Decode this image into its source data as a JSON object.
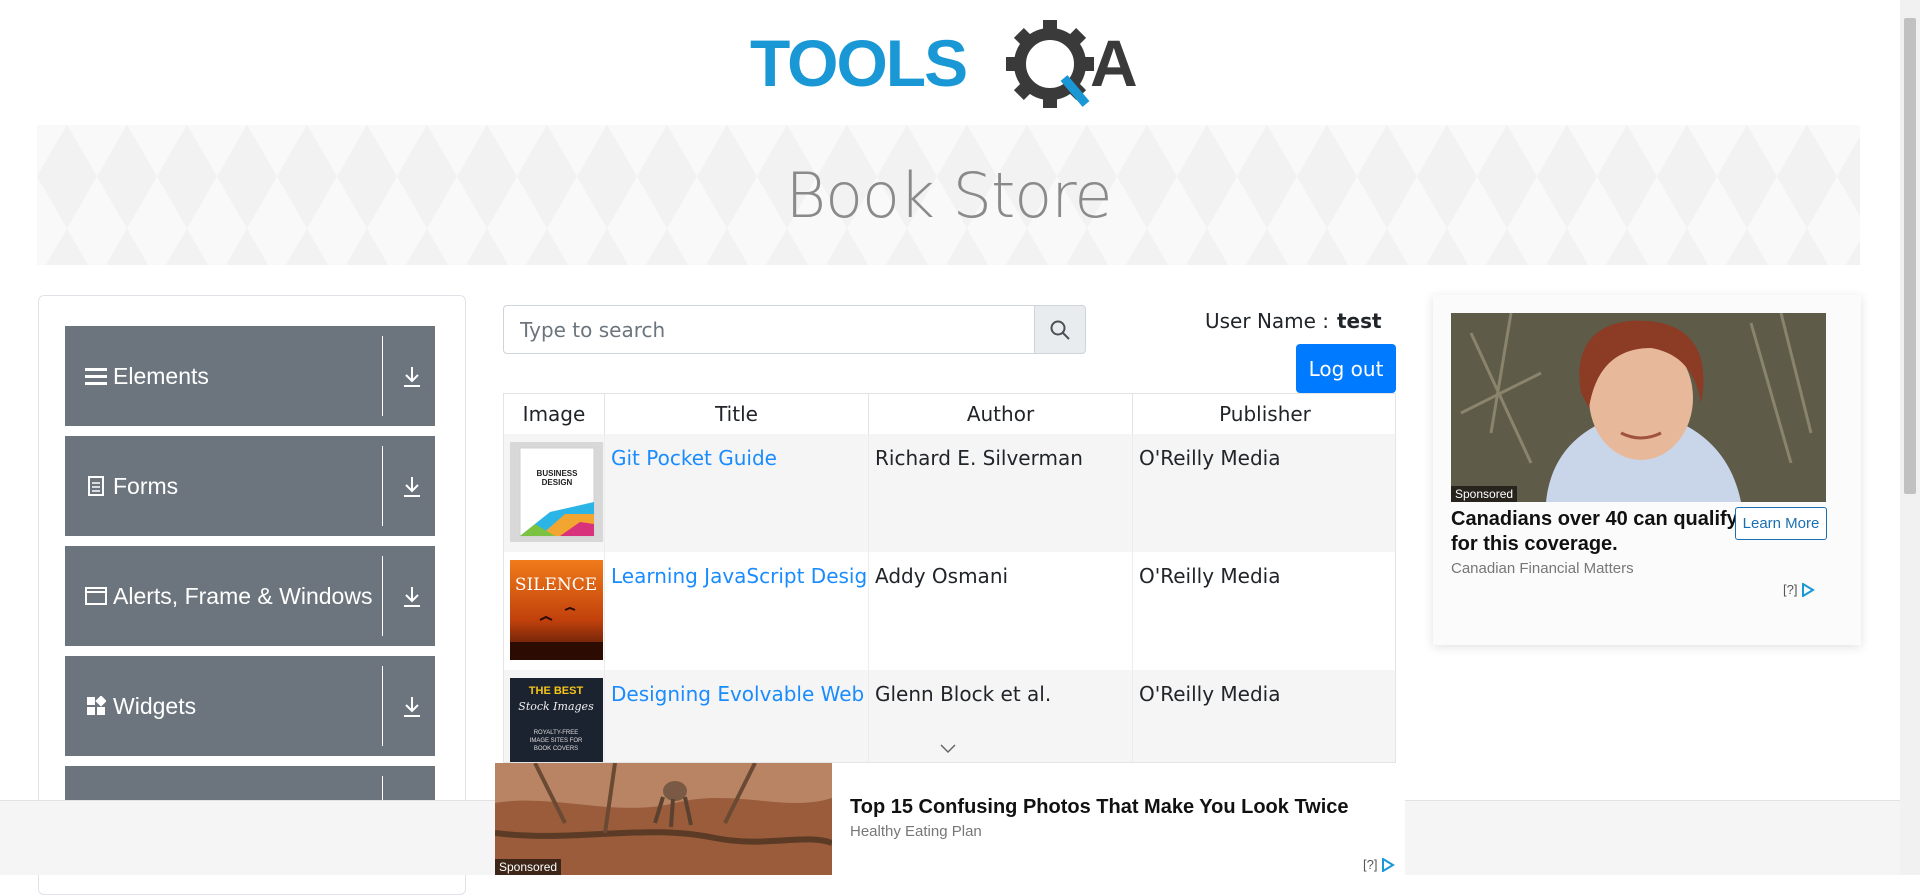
{
  "logo": {
    "text_left": "TOOLS",
    "text_right": "A",
    "alt": "TOOLSQA"
  },
  "banner": {
    "title": "Book Store"
  },
  "sidebar": {
    "groups": [
      {
        "label": "Elements",
        "icon": "hamburger-icon"
      },
      {
        "label": "Forms",
        "icon": "document-icon"
      },
      {
        "label": "Alerts, Frame & Windows",
        "icon": "window-icon"
      },
      {
        "label": "Widgets",
        "icon": "widgets-icon"
      },
      {
        "label": "",
        "icon": "download-icon"
      }
    ]
  },
  "search": {
    "placeholder": "Type to search"
  },
  "user": {
    "label": "User Name :",
    "name": "test",
    "logout_label": "Log out"
  },
  "table": {
    "columns": [
      "Image",
      "Title",
      "Author",
      "Publisher"
    ],
    "rows": [
      {
        "title": "Git Pocket Guide",
        "author": "Richard E. Silverman",
        "publisher": "O'Reilly Media",
        "cover": "business-design-cover"
      },
      {
        "title": "Learning JavaScript Design Patterns",
        "author": "Addy Osmani",
        "publisher": "O'Reilly Media",
        "cover": "silence-cover"
      },
      {
        "title": "Designing Evolvable Web APIs with ASP.NET",
        "author": "Glenn Block et al.",
        "publisher": "O'Reilly Media",
        "cover": "best-stock-images-cover"
      }
    ],
    "covers": {
      "business": {
        "line1": "BUSINESS",
        "line2": "DESIGN"
      },
      "silence": {
        "line1": "SILENCE"
      },
      "stock": {
        "line1": "THE BEST",
        "line2": "Stock Images",
        "line3": "ROYALTY-FREE",
        "line4": "IMAGE SITES FOR",
        "line5": "BOOK COVERS"
      }
    }
  },
  "ad_right": {
    "sponsored": "Sponsored",
    "headline": "Canadians over 40 can qualify for this coverage.",
    "source": "Canadian Financial Matters",
    "cta": "Learn More",
    "adchoices": "[?]"
  },
  "ad_bottom": {
    "sponsored": "Sponsored",
    "headline": "Top 15 Confusing Photos That Make You Look Twice",
    "source": "Healthy Eating Plan",
    "adchoices": "[?]"
  },
  "colors": {
    "brand_blue": "#1a98d5",
    "brand_dark": "#3a3a3a",
    "group_bg": "#6c757d",
    "primary": "#007bff",
    "link": "#1a8cff"
  }
}
